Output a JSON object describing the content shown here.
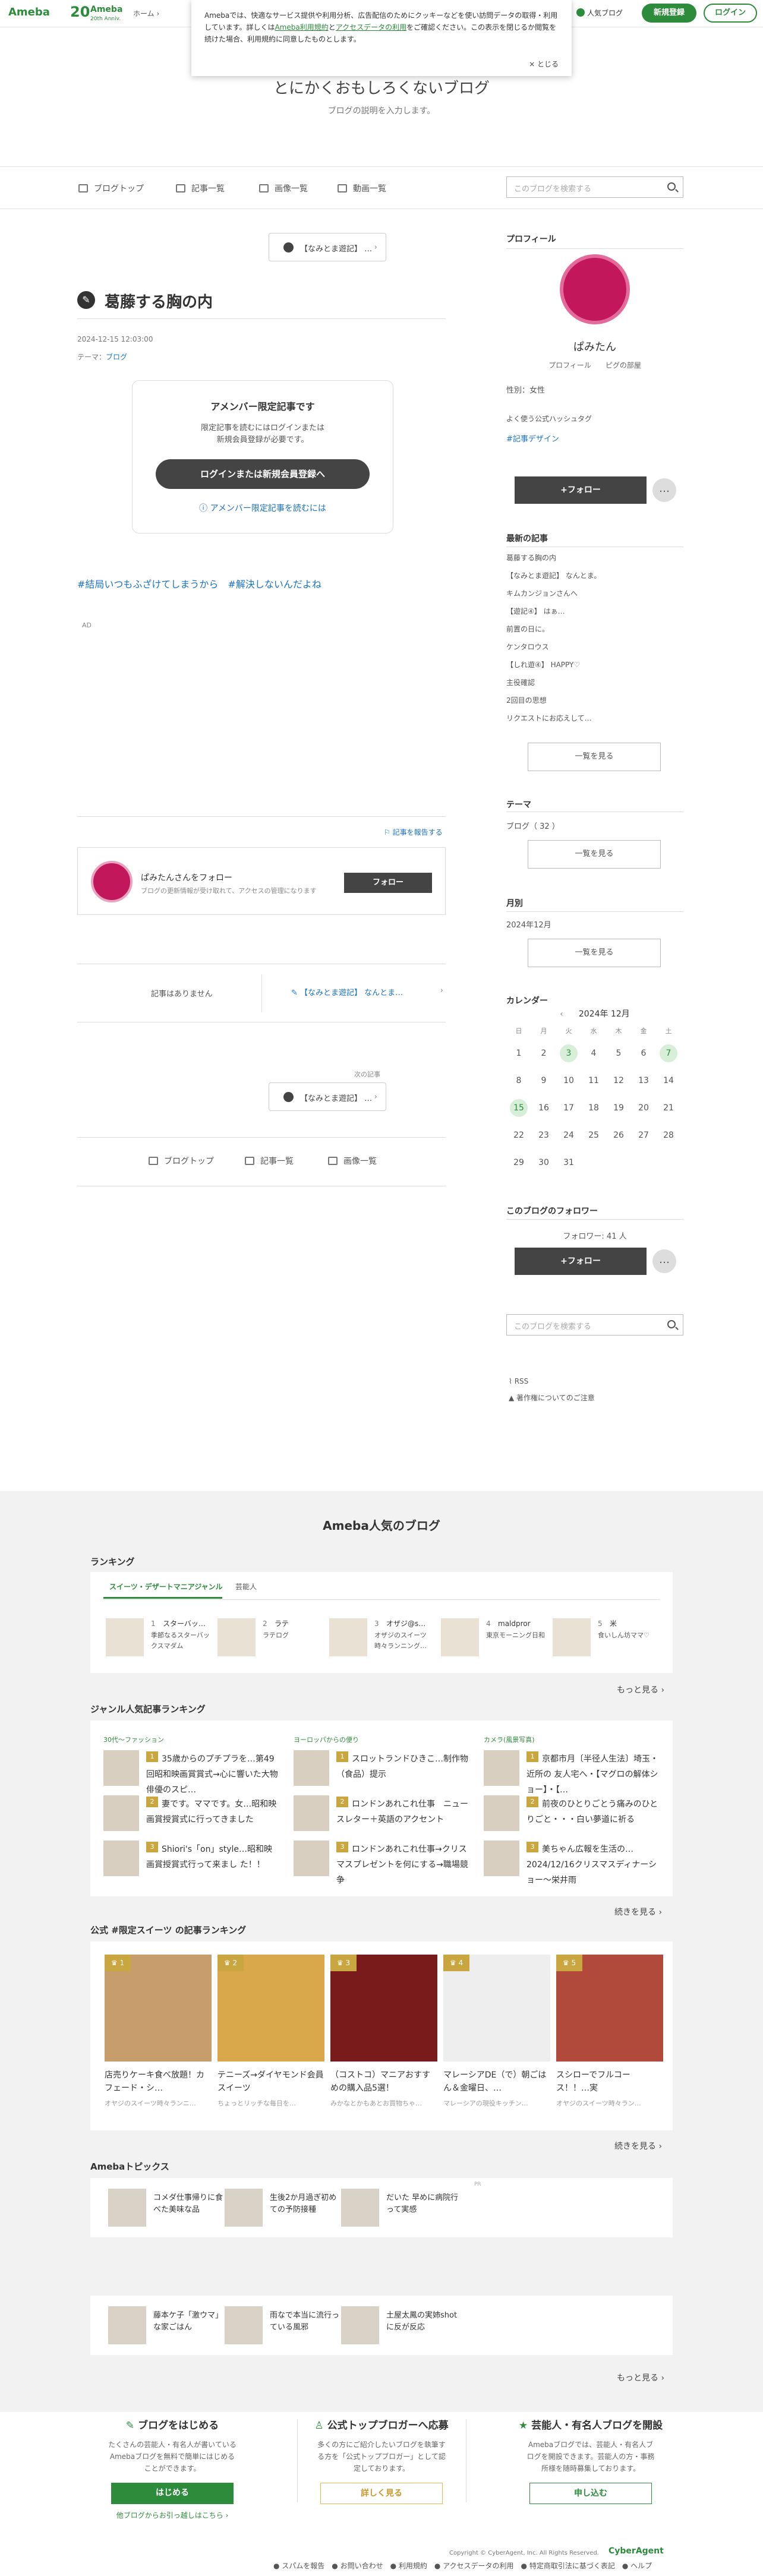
{
  "header": {
    "logo": "Ameba",
    "anniv_num": "20",
    "anniv_word": "Ameba",
    "anniv_sub": "20th Anniv.",
    "crumb": "ホーム › ",
    "popular": "人気ブログ",
    "signup": "新規登録",
    "login": "ログイン"
  },
  "cookie": {
    "text1": "Amebaでは、快適なサービス提供や利用分析、広告配信のためにクッキーなどを使い訪問データの取得・利用しています。詳しくは",
    "link1": "Ameba利用規約",
    "text2": "と",
    "link2": "アクセスデータの利用",
    "text3": "をご確認ください。この表示を閉じるか閲覧を続けた場合、利用規約に同意したものとします。",
    "close": "× とじる"
  },
  "blog": {
    "title": "とにかくおもしろくないブログ",
    "desc": "ブログの説明を入力します。"
  },
  "nav": {
    "top": "ブログトップ",
    "entries": "記事一覧",
    "images": "画像一覧",
    "videos": "動画一覧",
    "search_ph": "このブログを検索する"
  },
  "pager_top": "【なみとま遊記】 …",
  "entry": {
    "title": "葛藤する胸の内",
    "date": "2024-12-15 12:03:00",
    "theme_label": "テーマ：",
    "theme": "ブログ",
    "member_title": "アメンバー限定記事です",
    "member_desc1": "限定記事を読むにはログインまたは",
    "member_desc2": "新規会員登録が必要です。",
    "member_btn": "ログインまたは新規会員登録へ",
    "member_link": "アメンバー限定記事を読むには",
    "hashtags": "#結局いつもふざけてしまうから　#解決しないんだよね",
    "ad": "AD",
    "report": "記事を報告する"
  },
  "follow_card": {
    "title": "ぱみたんさんをフォロー",
    "desc": "ブログの更新情報が受け取れて、アクセスの管理になります",
    "btn": "フォロー"
  },
  "pager_bottom": {
    "none": "記事はありません",
    "next": "【なみとま遊記】 なんとま…",
    "next_label": "次の記事",
    "next2": "【なみとま遊記】 …"
  },
  "bottom_nav": {
    "top": "ブログトップ",
    "entries": "記事一覧",
    "images": "画像一覧"
  },
  "sidebar": {
    "profile_h": "プロフィール",
    "name": "ぱみたん",
    "profile_link": "プロフィール",
    "piggs": "ピグの部屋",
    "gender": "性別：女性",
    "hashtag1": "よく使う公式ハッシュタグ",
    "hashtag2": "#記事デザイン",
    "follow": "+フォロー",
    "dots": "…",
    "recent_h": "最新の記事",
    "recent": [
      "葛藤する胸の内",
      "【なみとま遊記】 なんとま。",
      "キムカンジョンさんへ",
      "【遊記④】 はぁ…",
      "前置の日に。",
      "ケンタロウス",
      "【しれ遊④】 HAPPY♡",
      "主役確認",
      "2回目の思想",
      "リクエストにお応えして…"
    ],
    "see_all": "一覧を見る",
    "theme_h": "テーマ",
    "theme_item": "ブログ（ 32 ）",
    "month_h": "月別",
    "month_item": "2024年12月",
    "cal_h": "カレンダー",
    "cal_month": "2024年 12月",
    "cal_days": [
      "日",
      "月",
      "火",
      "水",
      "木",
      "金",
      "土"
    ],
    "cal_weeks": [
      [
        "1",
        "2",
        "3",
        "4",
        "5",
        "6",
        "7"
      ],
      [
        "8",
        "9",
        "10",
        "11",
        "12",
        "13",
        "14"
      ],
      [
        "15",
        "16",
        "17",
        "18",
        "19",
        "20",
        "21"
      ],
      [
        "22",
        "23",
        "24",
        "25",
        "26",
        "27",
        "28"
      ],
      [
        "29",
        "30",
        "31",
        "",
        "",
        "",
        ""
      ]
    ],
    "followers_h": "このブログのフォロワー",
    "followers": "フォロワー: 41 人",
    "rss": "RSS",
    "notice": "著作権についてのご注意"
  },
  "popular": {
    "title": "Ameba人気のブログ",
    "ranking_h": "ランキング",
    "tab1": "スイーツ・デザートマニアジャンル",
    "tab2": "芸能人",
    "rank": [
      {
        "num": "1",
        "name": "スターバッ…",
        "desc": "季節なるスターバックスマダム"
      },
      {
        "num": "2",
        "name": "ラテ",
        "desc": "ラテログ"
      },
      {
        "num": "3",
        "name": "オザジ@s…",
        "desc": "オザジのスイーツ時々ランニング…"
      },
      {
        "num": "4",
        "name": "maldpror",
        "desc": "東京モーニング日和"
      },
      {
        "num": "5",
        "name": "米",
        "desc": "食いしん坊ママ♡"
      }
    ],
    "more": "もっと見る ›",
    "genre_h": "ジャンル人気記事ランキング",
    "g1h": "30代〜ファッション",
    "g2h": "ヨーロッパからの便り",
    "g3h": "カメラ(風景写真)",
    "g1": [
      "35歳からのプチプラを…第49回昭和映画賞賞式→心に響いた大物俳優のスピ…",
      "妻です。ママです。女…昭和映画賞授賞式に行ってきました",
      "Shiori's「on」style…昭和映画賞授賞式行って来まし た！！"
    ],
    "g2": [
      "スロットランドひきこ…制作物（食品）提示",
      "ロンドンあれこれ仕事　ニュースレター＋英語のアクセント",
      "ロンドンあれこれ仕事→クリスマスプレゼントを何にする→職場競争"
    ],
    "g3": [
      "京都市月〔半径人生法〕埼玉・近所の 友人宅へ・【マグロの解体ショー】・【…",
      "前夜のひとりごとう痛みのひとりごと・・・白い夢道に祈る",
      "美ちゃん広報を生活の…2024/12/16クリスマスディナーショー〜栄井雨"
    ],
    "more2": "続きを見る ›",
    "sweet_h": "公式 #限定スイーツ の記事ランキング",
    "sweets": [
      {
        "rank": "1",
        "title": "店売りケーキ食べ放題！カフェード・シ…",
        "author": "オヤジのスイーツ時々ランニ…"
      },
      {
        "rank": "2",
        "title": "テニーズ→ダイヤモンド会員スイーツ",
        "author": "ちょっとリッチな毎日を…"
      },
      {
        "rank": "3",
        "title": "（コストコ）マニアおすすめの購入品5選！",
        "author": "みかなとかもあとお買物ちゃ…"
      },
      {
        "rank": "4",
        "title": "マレーシアDE（で）朝ごはん＆金曜日、…",
        "author": "マレーシアの現役キッチン…"
      },
      {
        "rank": "5",
        "title": "スシローでフルコース！！…実",
        "author": "オヤジのスイーツ時々ラン…"
      }
    ],
    "topics_h": "Amebaトピックス",
    "topics": [
      "コメダ仕事帰りに食べた美味な品",
      "生後2か月過ぎ初めての予防接種",
      "だいた 早めに病院行って実感",
      "藤本ケ子「激ウマ」な家ごはん",
      "雨なで本当に流行っている風邪",
      "土屋太鳳の実姉shotに反が反応"
    ],
    "ad_mark": "PR",
    "more3": "もっと見る ›"
  },
  "footer": {
    "c1h": "ブログをはじめる",
    "c1d": "たくさんの芸能人・有名人が書いているAmebaブログを無料で簡単にはじめることができます。",
    "c1b": "はじめる",
    "c1l": "他ブログからお引っ越しはこちら ›",
    "c2h": "公式トップブロガーへ応募",
    "c2d": "多くの方にご紹介したいブログを執筆する方を「公式トップブロガー」として認定しております。",
    "c2b": "詳しく見る",
    "c3h": "芸能人・有名人ブログを開設",
    "c3d": "Amebaブログでは、芸能人・有名人ブログを開設できます。芸能人の方・事務所様を随時募集しております。",
    "c3b": "申し込む",
    "copyright": "Copyright © CyberAgent, Inc. All Rights Reserved.",
    "ca": "CyberAgent",
    "links": "● スパムを報告　● お問い合わせ　● 利用規約　● アクセスデータの利用　● 特定商取引法に基づく表記　● ヘルプ"
  },
  "colors": {
    "accent": "#2d8c3c",
    "link": "#1a73c8",
    "button_dark": "#444444"
  }
}
